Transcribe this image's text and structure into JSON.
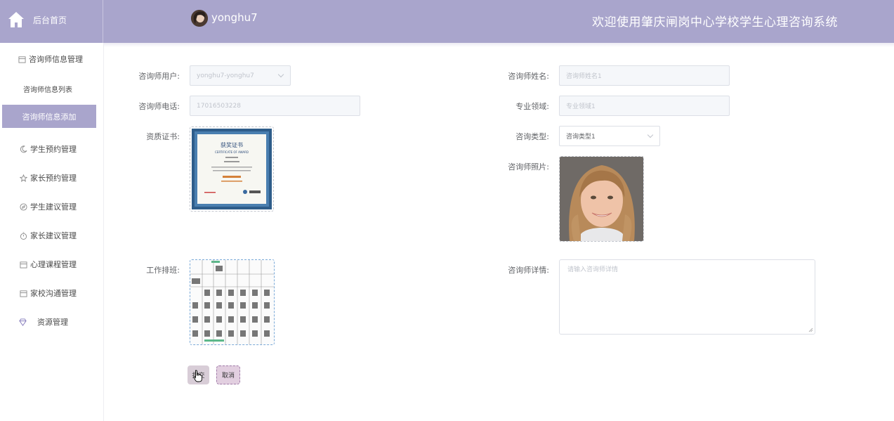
{
  "header": {
    "home_label": "后台首页",
    "username": "yonghu7",
    "system_title": "欢迎使用肇庆闸岗中心学校学生心理咨询系统"
  },
  "sidebar": {
    "items": [
      {
        "label": "咨询师信息管理",
        "icon": "calendar-icon"
      },
      {
        "label": "咨询师信息列表",
        "icon": ""
      },
      {
        "label": "咨询师信息添加",
        "icon": "",
        "active": true
      },
      {
        "label": "学生预约管理",
        "icon": "moon-icon"
      },
      {
        "label": "家长预约管理",
        "icon": "star-icon"
      },
      {
        "label": "学生建议管理",
        "icon": "compass-icon"
      },
      {
        "label": "家长建议管理",
        "icon": "timer-icon"
      },
      {
        "label": "心理课程管理",
        "icon": "calendar-icon"
      },
      {
        "label": "家校沟通管理",
        "icon": "calendar-icon"
      },
      {
        "label": "资源管理",
        "icon": "diamond-icon"
      }
    ]
  },
  "form": {
    "counselor_user": {
      "label": "咨询师用户:",
      "value": "yonghu7-yonghu7"
    },
    "counselor_name": {
      "label": "咨询师姓名:",
      "value": "咨询师姓名1"
    },
    "counselor_phone": {
      "label": "咨询师电话:",
      "value": "17016503228"
    },
    "specialty": {
      "label": "专业领域:",
      "value": "专业领域1"
    },
    "certificate": {
      "label": "资质证书:"
    },
    "consult_type": {
      "label": "咨询类型:",
      "value": "咨询类型1"
    },
    "photo": {
      "label": "咨询师照片:"
    },
    "schedule": {
      "label": "工作排班:"
    },
    "details": {
      "label": "咨询师详情:",
      "placeholder": "请输入咨询师详情"
    },
    "submit_label": "提交",
    "cancel_label": "取消"
  },
  "certificate_image": {
    "title": "获奖证书",
    "subtitle": "CERTIFICATE OF AWARD"
  },
  "colors": {
    "accent": "#a9a5cc"
  }
}
